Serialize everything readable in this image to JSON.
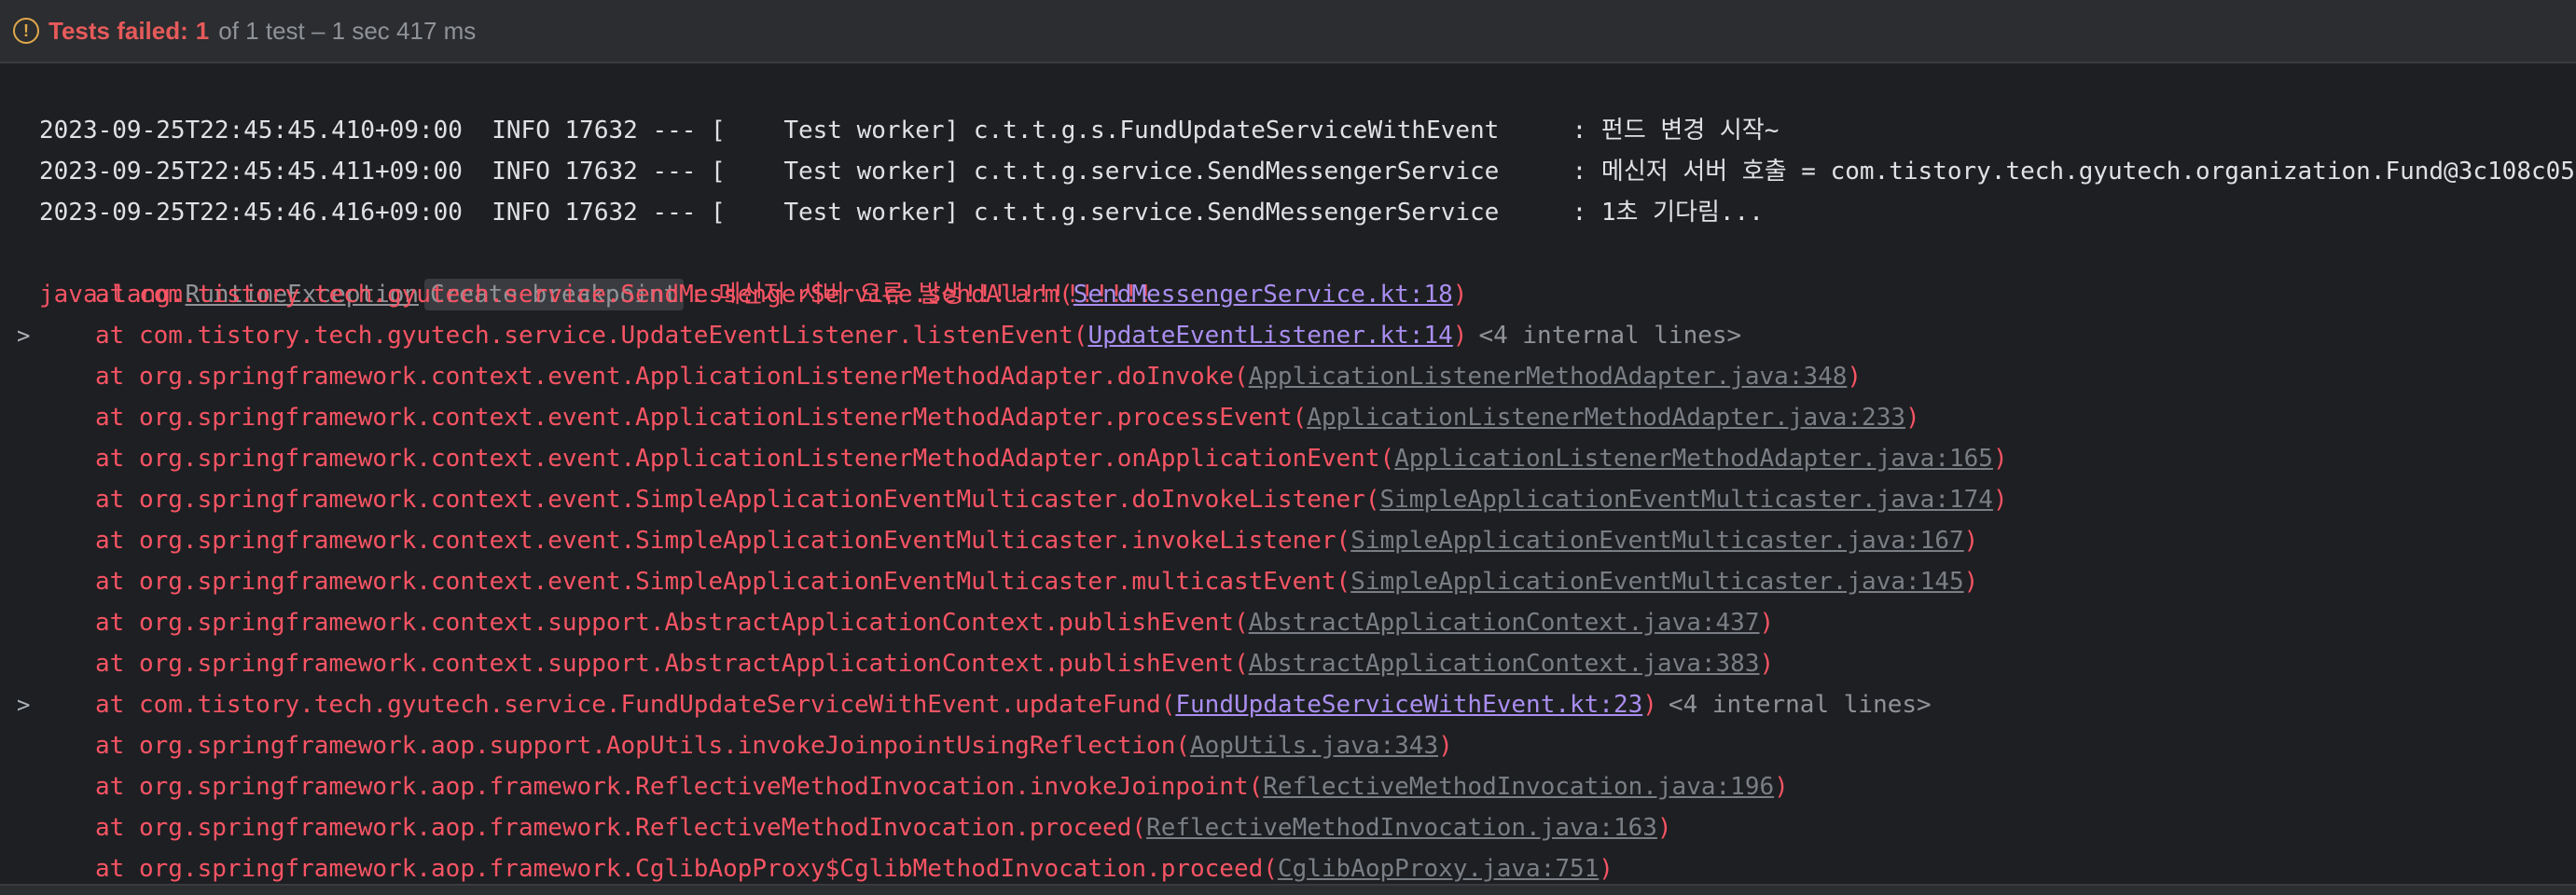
{
  "status": {
    "label": "Tests failed:",
    "count": "1",
    "rest": "of 1 test – 1 sec 417 ms",
    "icon": "warning-icon",
    "accent": "#e75a5a"
  },
  "info_lines": [
    "2023-09-25T22:45:45.410+09:00  INFO 17632 --- [    Test worker] c.t.t.g.s.FundUpdateServiceWithEvent     : 펀드 변경 시작~",
    "2023-09-25T22:45:45.411+09:00  INFO 17632 --- [    Test worker] c.t.t.g.service.SendMessengerService     : 메신저 서버 호출 = com.tistory.tech.gyutech.organization.Fund@3c108c05",
    "2023-09-25T22:45:46.416+09:00  INFO 17632 --- [    Test worker] c.t.t.g.service.SendMessengerService     : 1초 기다림..."
  ],
  "exception": {
    "prefix": "java.lang.",
    "class_link": "RuntimeException",
    "breakpoint_chip": "Create breakpoint",
    "message": ": 메신저 서버 오류 발생!!!!!!!!!!!!!"
  },
  "frames": [
    {
      "text": "at com.tistory.tech.gyutech.service.SendMessengerService.sendAlarm(",
      "link": "SendMessengerService.kt:18",
      "own": true,
      "internal": ""
    },
    {
      "text": "at com.tistory.tech.gyutech.service.UpdateEventListener.listenEvent(",
      "link": "UpdateEventListener.kt:14",
      "own": true,
      "internal": "<4 internal lines>"
    },
    {
      "text": "at org.springframework.context.event.ApplicationListenerMethodAdapter.doInvoke(",
      "link": "ApplicationListenerMethodAdapter.java:348",
      "own": false,
      "internal": ""
    },
    {
      "text": "at org.springframework.context.event.ApplicationListenerMethodAdapter.processEvent(",
      "link": "ApplicationListenerMethodAdapter.java:233",
      "own": false,
      "internal": ""
    },
    {
      "text": "at org.springframework.context.event.ApplicationListenerMethodAdapter.onApplicationEvent(",
      "link": "ApplicationListenerMethodAdapter.java:165",
      "own": false,
      "internal": ""
    },
    {
      "text": "at org.springframework.context.event.SimpleApplicationEventMulticaster.doInvokeListener(",
      "link": "SimpleApplicationEventMulticaster.java:174",
      "own": false,
      "internal": ""
    },
    {
      "text": "at org.springframework.context.event.SimpleApplicationEventMulticaster.invokeListener(",
      "link": "SimpleApplicationEventMulticaster.java:167",
      "own": false,
      "internal": ""
    },
    {
      "text": "at org.springframework.context.event.SimpleApplicationEventMulticaster.multicastEvent(",
      "link": "SimpleApplicationEventMulticaster.java:145",
      "own": false,
      "internal": ""
    },
    {
      "text": "at org.springframework.context.support.AbstractApplicationContext.publishEvent(",
      "link": "AbstractApplicationContext.java:437",
      "own": false,
      "internal": ""
    },
    {
      "text": "at org.springframework.context.support.AbstractApplicationContext.publishEvent(",
      "link": "AbstractApplicationContext.java:383",
      "own": false,
      "internal": ""
    },
    {
      "text": "at com.tistory.tech.gyutech.service.FundUpdateServiceWithEvent.updateFund(",
      "link": "FundUpdateServiceWithEvent.kt:23",
      "own": true,
      "internal": "<4 internal lines>"
    },
    {
      "text": "at org.springframework.aop.support.AopUtils.invokeJoinpointUsingReflection(",
      "link": "AopUtils.java:343",
      "own": false,
      "internal": ""
    },
    {
      "text": "at org.springframework.aop.framework.ReflectiveMethodInvocation.invokeJoinpoint(",
      "link": "ReflectiveMethodInvocation.java:196",
      "own": false,
      "internal": ""
    },
    {
      "text": "at org.springframework.aop.framework.ReflectiveMethodInvocation.proceed(",
      "link": "ReflectiveMethodInvocation.java:163",
      "own": false,
      "internal": ""
    },
    {
      "text": "at org.springframework.aop.framework.CglibAopProxy$CglibMethodInvocation.proceed(",
      "link": "CglibAopProxy.java:751",
      "own": false,
      "internal": ""
    }
  ],
  "closing_paren": ")",
  "expander_glyph": ">"
}
